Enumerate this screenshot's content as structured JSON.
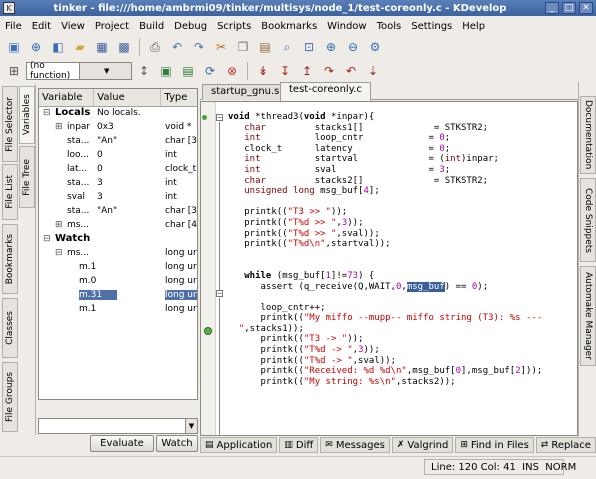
{
  "window": {
    "title": "tinker - file:///home/ambrmi09/tinker/multisys/node_1/test-coreonly.c - KDevelop",
    "close_label": "✕",
    "max_label": "□",
    "min_label": "_"
  },
  "menubar": [
    "File",
    "Edit",
    "View",
    "Project",
    "Build",
    "Debug",
    "Scripts",
    "Bookmarks",
    "Window",
    "Tools",
    "Settings",
    "Help"
  ],
  "toolbar": {
    "function_combo": "(no function)"
  },
  "left_tabs": [
    "File Selector",
    "File List",
    "Bookmarks",
    "Classes",
    "File Groups",
    "Variables",
    "File Tree"
  ],
  "right_tabs": [
    "Documentation",
    "Code Snippets",
    "Automake Manager"
  ],
  "variables": {
    "headers": [
      "Variable",
      "Value",
      "Type"
    ],
    "rows": [
      {
        "toggle": "⊟",
        "name": "Locals",
        "value": "No locals.",
        "type": "",
        "bold": true,
        "indent": 0
      },
      {
        "toggle": "⊞",
        "name": "inpar",
        "value": "0x3",
        "type": "void *",
        "indent": 1
      },
      {
        "toggle": "",
        "name": "sta...",
        "value": "\"An\"",
        "type": "char [3",
        "indent": 1
      },
      {
        "toggle": "",
        "name": "loo...",
        "value": "0",
        "type": "int",
        "indent": 1
      },
      {
        "toggle": "",
        "name": "lat...",
        "value": "0",
        "type": "clock_t",
        "indent": 1
      },
      {
        "toggle": "",
        "name": "sta...",
        "value": "3",
        "type": "int",
        "indent": 1
      },
      {
        "toggle": "",
        "name": "sval",
        "value": "3",
        "type": "int",
        "indent": 1
      },
      {
        "toggle": "",
        "name": "sta...",
        "value": "\"An\"",
        "type": "char [3",
        "indent": 1
      },
      {
        "toggle": "⊞",
        "name": "ms...",
        "value": "",
        "type": "char [4",
        "indent": 1
      },
      {
        "toggle": "⊟",
        "name": "Watch",
        "value": "",
        "type": "",
        "bold": true,
        "indent": 0
      },
      {
        "toggle": "⊟",
        "name": "ms...",
        "value": "",
        "type": "long ur",
        "indent": 1
      },
      {
        "toggle": "",
        "name": "m.1",
        "value": "",
        "type": "long ur",
        "indent": 2
      },
      {
        "toggle": "",
        "name": "m.0",
        "value": "",
        "type": "long ur",
        "indent": 2
      },
      {
        "toggle": "",
        "name": "m.31",
        "value": "",
        "type": "long ur",
        "indent": 2,
        "selected": true
      },
      {
        "toggle": "",
        "name": "m.1",
        "value": "",
        "type": "long ur",
        "indent": 2
      }
    ],
    "evaluate_label": "Evaluate",
    "watch_label": "Watch"
  },
  "editor": {
    "tabs": [
      "startup_gnu.s",
      "test-coreonly.c"
    ],
    "active_tab": 1,
    "lines": [
      [
        [
          "kw",
          "void"
        ],
        [
          "p",
          " *thread3("
        ],
        [
          "kw",
          "void"
        ],
        [
          "p",
          " *inpar){"
        ]
      ],
      [
        [
          "ty",
          "   char"
        ],
        [
          "p",
          "         stacks1[]             = STKSTR2;"
        ]
      ],
      [
        [
          "ty",
          "   int"
        ],
        [
          "p",
          "          loop_cntr            = "
        ],
        [
          "num",
          "0"
        ],
        [
          "p",
          ";"
        ]
      ],
      [
        [
          "p",
          "   clock_t      latency              = "
        ],
        [
          "num",
          "0"
        ],
        [
          "p",
          ";"
        ]
      ],
      [
        [
          "ty",
          "   int"
        ],
        [
          "p",
          "          startval             = ("
        ],
        [
          "ty",
          "int"
        ],
        [
          "p",
          ")inpar;"
        ]
      ],
      [
        [
          "ty",
          "   int"
        ],
        [
          "p",
          "          sval                 = "
        ],
        [
          "num",
          "3"
        ],
        [
          "p",
          ";"
        ]
      ],
      [
        [
          "ty",
          "   char"
        ],
        [
          "p",
          "         stacks2[]             = STKSTR2;"
        ]
      ],
      [
        [
          "ty",
          "   unsigned long"
        ],
        [
          "p",
          " msg_buf["
        ],
        [
          "num",
          "4"
        ],
        [
          "p",
          "];"
        ]
      ],
      [
        [
          "p",
          ""
        ]
      ],
      [
        [
          "p",
          "   printk(("
        ],
        [
          "str",
          "\"T3 >> \""
        ],
        [
          "p",
          "));"
        ]
      ],
      [
        [
          "p",
          "   printk(("
        ],
        [
          "str",
          "\"T%d >> \""
        ],
        [
          "p",
          ","
        ],
        [
          "num",
          "3"
        ],
        [
          "p",
          "));"
        ]
      ],
      [
        [
          "p",
          "   printk(("
        ],
        [
          "str",
          "\"T%d >> \""
        ],
        [
          "p",
          ",sval));"
        ]
      ],
      [
        [
          "p",
          "   printk(("
        ],
        [
          "str",
          "\"T%d\\n\""
        ],
        [
          "p",
          ",startval));"
        ]
      ],
      [
        [
          "p",
          ""
        ]
      ],
      [
        [
          "p",
          ""
        ]
      ],
      [
        [
          "kw",
          "   while"
        ],
        [
          "p",
          " (msg_buf["
        ],
        [
          "num",
          "1"
        ],
        [
          "p",
          "]!="
        ],
        [
          "num",
          "73"
        ],
        [
          "p",
          ") {"
        ]
      ],
      [
        [
          "p",
          "      assert (q_receive(Q,WAIT,"
        ],
        [
          "num",
          "0"
        ],
        [
          "p",
          ","
        ],
        [
          "hl",
          "msg_buf"
        ],
        [
          "p",
          ") == "
        ],
        [
          "num",
          "0"
        ],
        [
          "p",
          ");"
        ]
      ],
      [
        [
          "p",
          ""
        ]
      ],
      [
        [
          "p",
          "      loop_cntr++;"
        ]
      ],
      [
        [
          "p",
          "      printk(("
        ],
        [
          "str",
          "\"My miffo --mupp-- miffo string (T3): %s ---"
        ]
      ],
      [
        [
          "p",
          "  "
        ],
        [
          "str",
          "\""
        ],
        [
          "p",
          ",stacks1));"
        ]
      ],
      [
        [
          "p",
          "      printk(("
        ],
        [
          "str",
          "\"T3 -> \""
        ],
        [
          "p",
          "));"
        ]
      ],
      [
        [
          "p",
          "      printk(("
        ],
        [
          "str",
          "\"T%d -> \""
        ],
        [
          "p",
          ","
        ],
        [
          "num",
          "3"
        ],
        [
          "p",
          "));"
        ]
      ],
      [
        [
          "p",
          "      printk(("
        ],
        [
          "str",
          "\"T%d -> \""
        ],
        [
          "p",
          ",sval));"
        ]
      ],
      [
        [
          "p",
          "      printk(("
        ],
        [
          "str",
          "\"Received: %d %d\\n\""
        ],
        [
          "p",
          ",msg_buf["
        ],
        [
          "num",
          "0"
        ],
        [
          "p",
          "],msg_buf["
        ],
        [
          "num",
          "2"
        ],
        [
          "p",
          "]));"
        ]
      ],
      [
        [
          "p",
          "      printk(("
        ],
        [
          "str",
          "\"My string: %s\\n\""
        ],
        [
          "p",
          ",stacks2));"
        ]
      ]
    ]
  },
  "bottom_tabs": [
    {
      "icon": "application-icon",
      "glyph": "▤",
      "label": "Application"
    },
    {
      "icon": "diff-icon",
      "glyph": "▥",
      "label": "Diff"
    },
    {
      "icon": "messages-icon",
      "glyph": "✉",
      "label": "Messages"
    },
    {
      "icon": "valgrind-icon",
      "glyph": "✗",
      "label": "Valgrind"
    },
    {
      "icon": "find-in-files-icon",
      "glyph": "⊞",
      "label": "Find in Files"
    },
    {
      "icon": "replace-icon",
      "glyph": "⇄",
      "label": "Replace"
    }
  ],
  "statusbar": {
    "position": "Line: 120 Col: 41  INS  NORM"
  },
  "colors": {
    "selection": "#4f71a8",
    "highlight": "#3b5e9a",
    "titlebar": "#4a6fae"
  }
}
